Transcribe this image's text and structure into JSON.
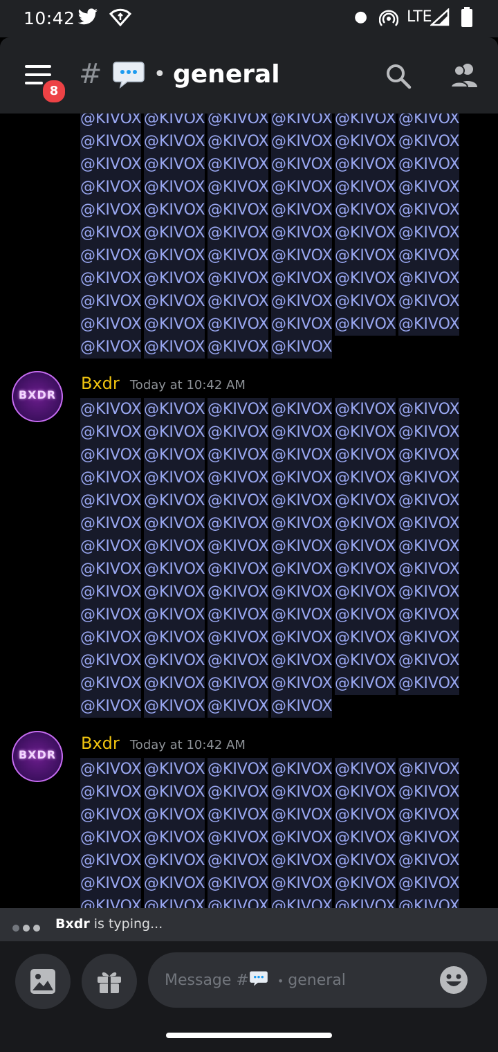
{
  "status_bar": {
    "time": "10:42",
    "network": "LTE",
    "icons": [
      "twitter-icon",
      "wifi-icon",
      "notification-dot",
      "hotspot-icon",
      "signal-icon",
      "battery-icon"
    ]
  },
  "header": {
    "badge_count": "8",
    "hash": "#",
    "channel_name": "general",
    "bullet": "•"
  },
  "messages": {
    "top_partial": {
      "mention": "@KIVOX",
      "count": 64
    },
    "msg1": {
      "avatar_text": "BXDR",
      "username": "Bxdr",
      "timestamp": "Today at 10:42 AM",
      "mention": "@KIVOX",
      "count": 82
    },
    "msg2": {
      "avatar_text": "BXDR",
      "username": "Bxdr",
      "timestamp": "Today at 10:42 AM",
      "mention": "@KIVOX",
      "count": 42
    }
  },
  "typing": {
    "user": "Bxdr",
    "text": "is typing..."
  },
  "composer": {
    "placeholder_prefix": "Message #",
    "placeholder_bullet": "•",
    "placeholder_channel": "general"
  },
  "colors": {
    "mention_bg": "#171a2a",
    "mention_text": "#9aa8f2",
    "username": "#f1c40f",
    "badge": "#ed4245",
    "header_bg": "#202225"
  }
}
